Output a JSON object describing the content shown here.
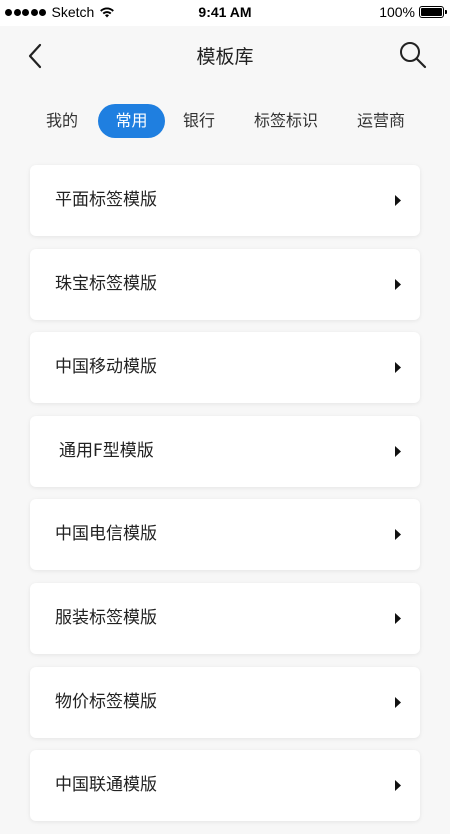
{
  "status_bar": {
    "carrier": "Sketch",
    "time": "9:41 AM",
    "battery": "100%"
  },
  "nav": {
    "title": "模板库",
    "back_icon": "chevron-left-icon",
    "search_icon": "search-icon"
  },
  "tabs": [
    {
      "label": "我的",
      "active": false
    },
    {
      "label": "常用",
      "active": true
    },
    {
      "label": "银行",
      "active": false
    },
    {
      "label": "标签标识",
      "active": false
    },
    {
      "label": "运营商",
      "active": false
    }
  ],
  "templates": [
    {
      "label": "平面标签模版"
    },
    {
      "label": "珠宝标签模版"
    },
    {
      "label": "中国移动模版"
    },
    {
      "label": "通用F型模版"
    },
    {
      "label": "中国电信模版"
    },
    {
      "label": "服装标签模版"
    },
    {
      "label": "物价标签模版"
    },
    {
      "label": "中国联通模版"
    }
  ],
  "colors": {
    "accent": "#1f7fe0",
    "background": "#f7f7f7",
    "card": "#ffffff"
  }
}
